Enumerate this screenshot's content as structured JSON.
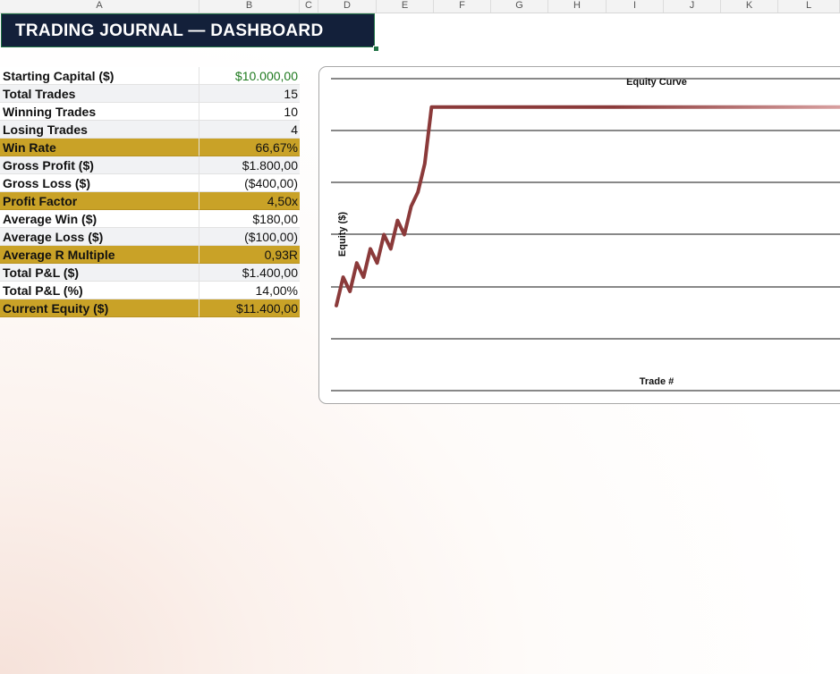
{
  "columns": [
    "A",
    "B",
    "C",
    "D",
    "E",
    "F",
    "G",
    "H",
    "I",
    "J",
    "K",
    "L"
  ],
  "banner": {
    "title": "TRADING JOURNAL — DASHBOARD"
  },
  "stats": [
    {
      "label": "Starting Capital ($)",
      "value": "$10.000,00",
      "highlight": false,
      "value_color": "#1f7a1f"
    },
    {
      "label": "Total Trades",
      "value": "15",
      "highlight": false
    },
    {
      "label": "Winning Trades",
      "value": "10",
      "highlight": false
    },
    {
      "label": "Losing Trades",
      "value": "4",
      "highlight": false
    },
    {
      "label": "Win Rate",
      "value": "66,67%",
      "highlight": true
    },
    {
      "label": "Gross Profit ($)",
      "value": "$1.800,00",
      "highlight": false
    },
    {
      "label": "Gross Loss ($)",
      "value": "($400,00)",
      "highlight": false
    },
    {
      "label": "Profit Factor",
      "value": "4,50x",
      "highlight": true
    },
    {
      "label": "Average Win ($)",
      "value": "$180,00",
      "highlight": false
    },
    {
      "label": "Average Loss ($)",
      "value": "($100,00)",
      "highlight": false
    },
    {
      "label": "Average R Multiple",
      "value": "0,93R",
      "highlight": true
    },
    {
      "label": "Total P&L ($)",
      "value": "$1.400,00",
      "highlight": false
    },
    {
      "label": "Total P&L (%)",
      "value": "14,00%",
      "highlight": false
    },
    {
      "label": "Current Equity ($)",
      "value": "$11.400,00",
      "highlight": true
    }
  ],
  "colors": {
    "banner_bg": "#13203a",
    "highlight": "#c9a227",
    "line": "#8b3a3a",
    "positive": "#1f7a1f"
  },
  "chart_data": {
    "type": "line",
    "title": "Equity Curve",
    "xlabel": "Trade #",
    "ylabel": "Equity ($)",
    "x": [
      1,
      2,
      3,
      4,
      5,
      6,
      7,
      8,
      9,
      10,
      11,
      12,
      13,
      14,
      15,
      16,
      17,
      18,
      19,
      20,
      21,
      22,
      23,
      24,
      25,
      26,
      27,
      28,
      29,
      30
    ],
    "series": [
      {
        "values": [
          10000,
          10200,
          10100,
          10300,
          10200,
          10400,
          10300,
          10500,
          10400,
          10600,
          10500,
          10700,
          10800,
          11000,
          11400,
          11400,
          11400,
          11400,
          11400,
          11400,
          11400,
          11400,
          11400,
          11400,
          11400,
          11400,
          11400,
          11400,
          11400,
          11400
        ]
      }
    ],
    "grid": true
  }
}
